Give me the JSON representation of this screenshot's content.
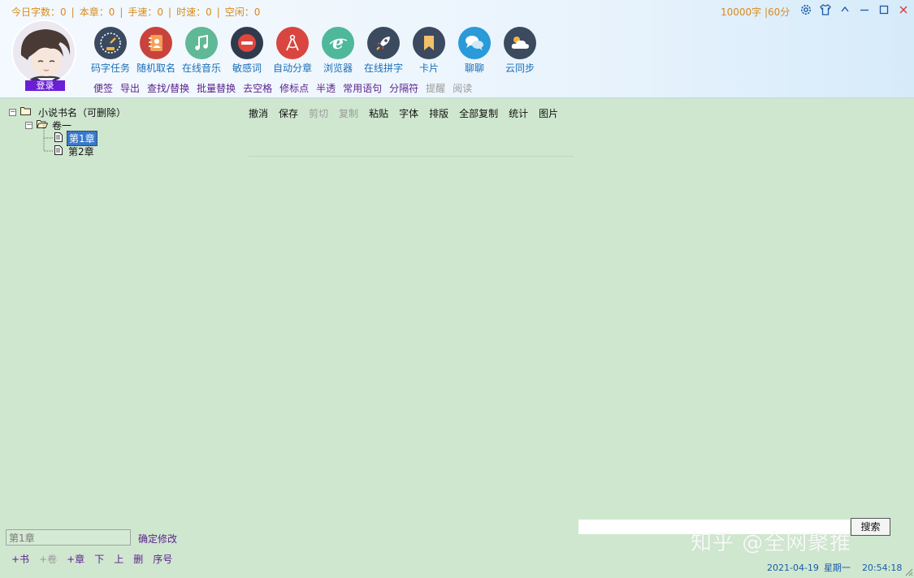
{
  "status": {
    "today_words": "今日字数：0",
    "chapter": "本章：0",
    "hand_speed": "手速：0",
    "time_speed": "时速：0",
    "idle": "空闲：0",
    "separator": "|"
  },
  "goal": "10000字 |60分",
  "user": {
    "login_label": "登录"
  },
  "tools": [
    {
      "label": "码字任务",
      "icon": "speedometer-icon",
      "color": "#3b4a5e"
    },
    {
      "label": "随机取名",
      "icon": "address-book-icon",
      "color": "#c9433c"
    },
    {
      "label": "在线音乐",
      "icon": "music-note-icon",
      "color": "#5fb896"
    },
    {
      "label": "敏感词",
      "icon": "minus-icon",
      "color": "#2f3b4d"
    },
    {
      "label": "自动分章",
      "icon": "compass-icon",
      "color": "#d8463f"
    },
    {
      "label": "浏览器",
      "icon": "browser-icon",
      "color": "#4fb89b"
    },
    {
      "label": "在线拼字",
      "icon": "rocket-icon",
      "color": "#3b4a5e"
    },
    {
      "label": "卡片",
      "icon": "bookmark-icon",
      "color": "#3b4a5e"
    },
    {
      "label": "聊聊",
      "icon": "chat-icon",
      "color": "#2a9ad8"
    },
    {
      "label": "云同步",
      "icon": "cloud-icon",
      "color": "#3b4a5e"
    }
  ],
  "subtools": [
    "便签",
    "导出",
    "查找/替换",
    "批量替换",
    "去空格",
    "修标点",
    "半透",
    "常用语句",
    "分隔符",
    "提醒",
    "阅读"
  ],
  "tree": {
    "book": "小说书名（可删除）",
    "volume": "卷一",
    "chapters": [
      "第1章",
      "第2章"
    ]
  },
  "editor_toolbar": [
    "撤消",
    "保存",
    "剪切",
    "复制",
    "粘贴",
    "字体",
    "排版",
    "全部复制",
    "统计",
    "图片"
  ],
  "chapter_edit": {
    "value": "第1章",
    "confirm": "确定修改"
  },
  "bottom_actions": [
    "+书",
    "+卷",
    "+章",
    "下",
    "上",
    "删",
    "序号"
  ],
  "search": {
    "button": "搜索"
  },
  "watermark": "知乎 @全网聚推",
  "datetime": {
    "date": "2021-04-19",
    "weekday": "星期一",
    "time": "20:54:18"
  }
}
